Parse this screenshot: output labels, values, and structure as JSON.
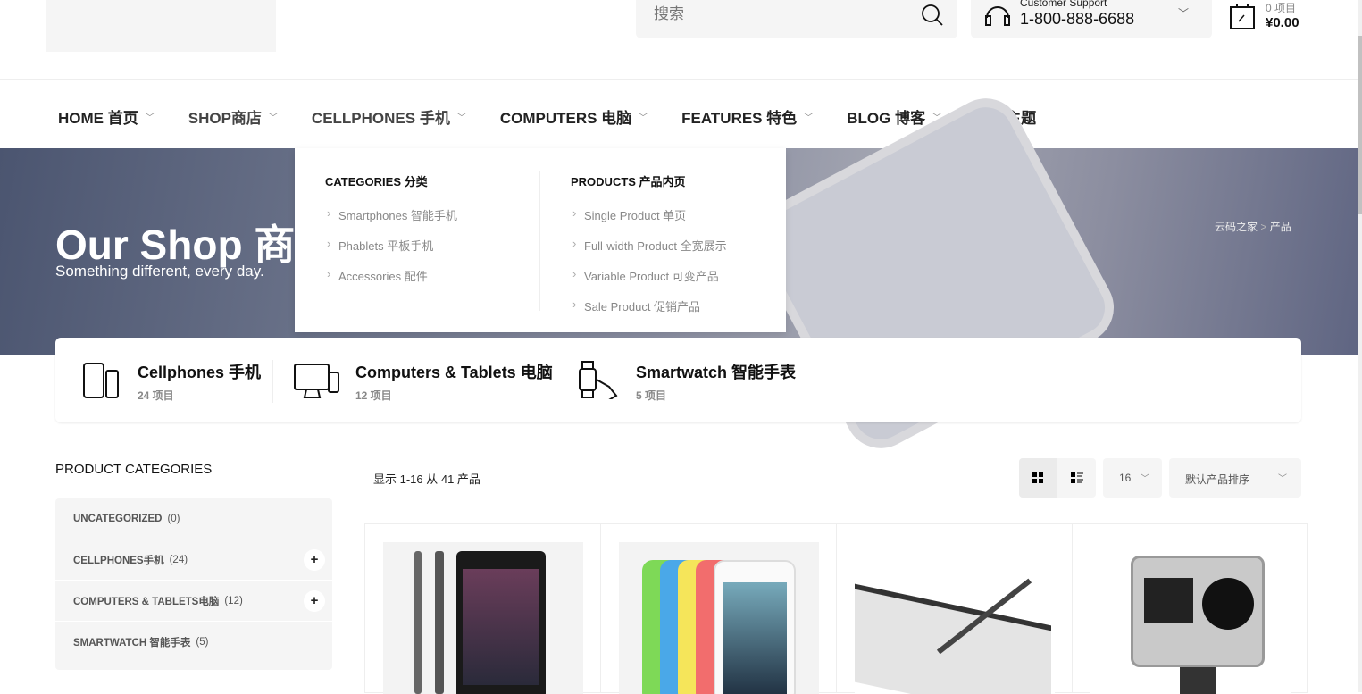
{
  "header": {
    "search_placeholder": "搜索",
    "support_label": "Customer Support",
    "support_phone": "1-800-888-6688",
    "cart_count": "0 项目",
    "cart_total": "¥0.00"
  },
  "nav": [
    {
      "label": "HOME 首页",
      "chevron": true
    },
    {
      "label": "SHOP商店",
      "chevron": true
    },
    {
      "label": "CELLPHONES 手机",
      "chevron": true
    },
    {
      "label": "COMPUTERS 电脑",
      "chevron": true
    },
    {
      "label": "FEATURES 特色",
      "chevron": true
    },
    {
      "label": "BLOG 博客",
      "chevron": true
    },
    {
      "label": "购买主题",
      "chevron": false
    }
  ],
  "dropdown": {
    "categories": {
      "title": "CATEGORIES 分类",
      "links": [
        "Smartphones 智能手机",
        "Phablets 平板手机",
        "Accessories 配件"
      ]
    },
    "products": {
      "title": "PRODUCTS 产品内页",
      "links": [
        "Single Product 单页",
        "Full-width Product 全宽展示",
        "Variable Product 可变产品",
        "Sale Product 促销产品"
      ]
    }
  },
  "hero": {
    "title": "Our Shop 商店",
    "subtitle": "Something different, every day.",
    "breadcrumb_home": "云码之家",
    "breadcrumb_sep": ">",
    "breadcrumb_current": "产品"
  },
  "category_strip": [
    {
      "name": "Cellphones 手机",
      "count": "24 项目",
      "icon": "cellphone-icon"
    },
    {
      "name": "Computers & Tablets 电脑",
      "count": "12 项目",
      "icon": "computer-icon"
    },
    {
      "name": "Smartwatch 智能手表",
      "count": "5 项目",
      "icon": "smartwatch-icon"
    }
  ],
  "sidebar": {
    "title": "PRODUCT CATEGORIES",
    "items": [
      {
        "label": "UNCATEGORIZED",
        "count": "(0)",
        "expandable": false
      },
      {
        "label": "CELLPHONES手机",
        "count": "(24)",
        "expandable": true
      },
      {
        "label": "COMPUTERS & TABLETS电脑",
        "count": "(12)",
        "expandable": true
      },
      {
        "label": "SMARTWATCH 智能手表",
        "count": "(5)",
        "expandable": false
      }
    ]
  },
  "toolbar": {
    "result_text": "显示 1-16 从 41 产品",
    "per_page": "16",
    "sort": "默认产品排序",
    "view": "grid"
  },
  "products": [
    {
      "image": "sony-xperia-phone"
    },
    {
      "image": "iphone-5c-colors"
    },
    {
      "image": "drawing-tablet-pen"
    },
    {
      "image": "gopro-hero4"
    }
  ]
}
